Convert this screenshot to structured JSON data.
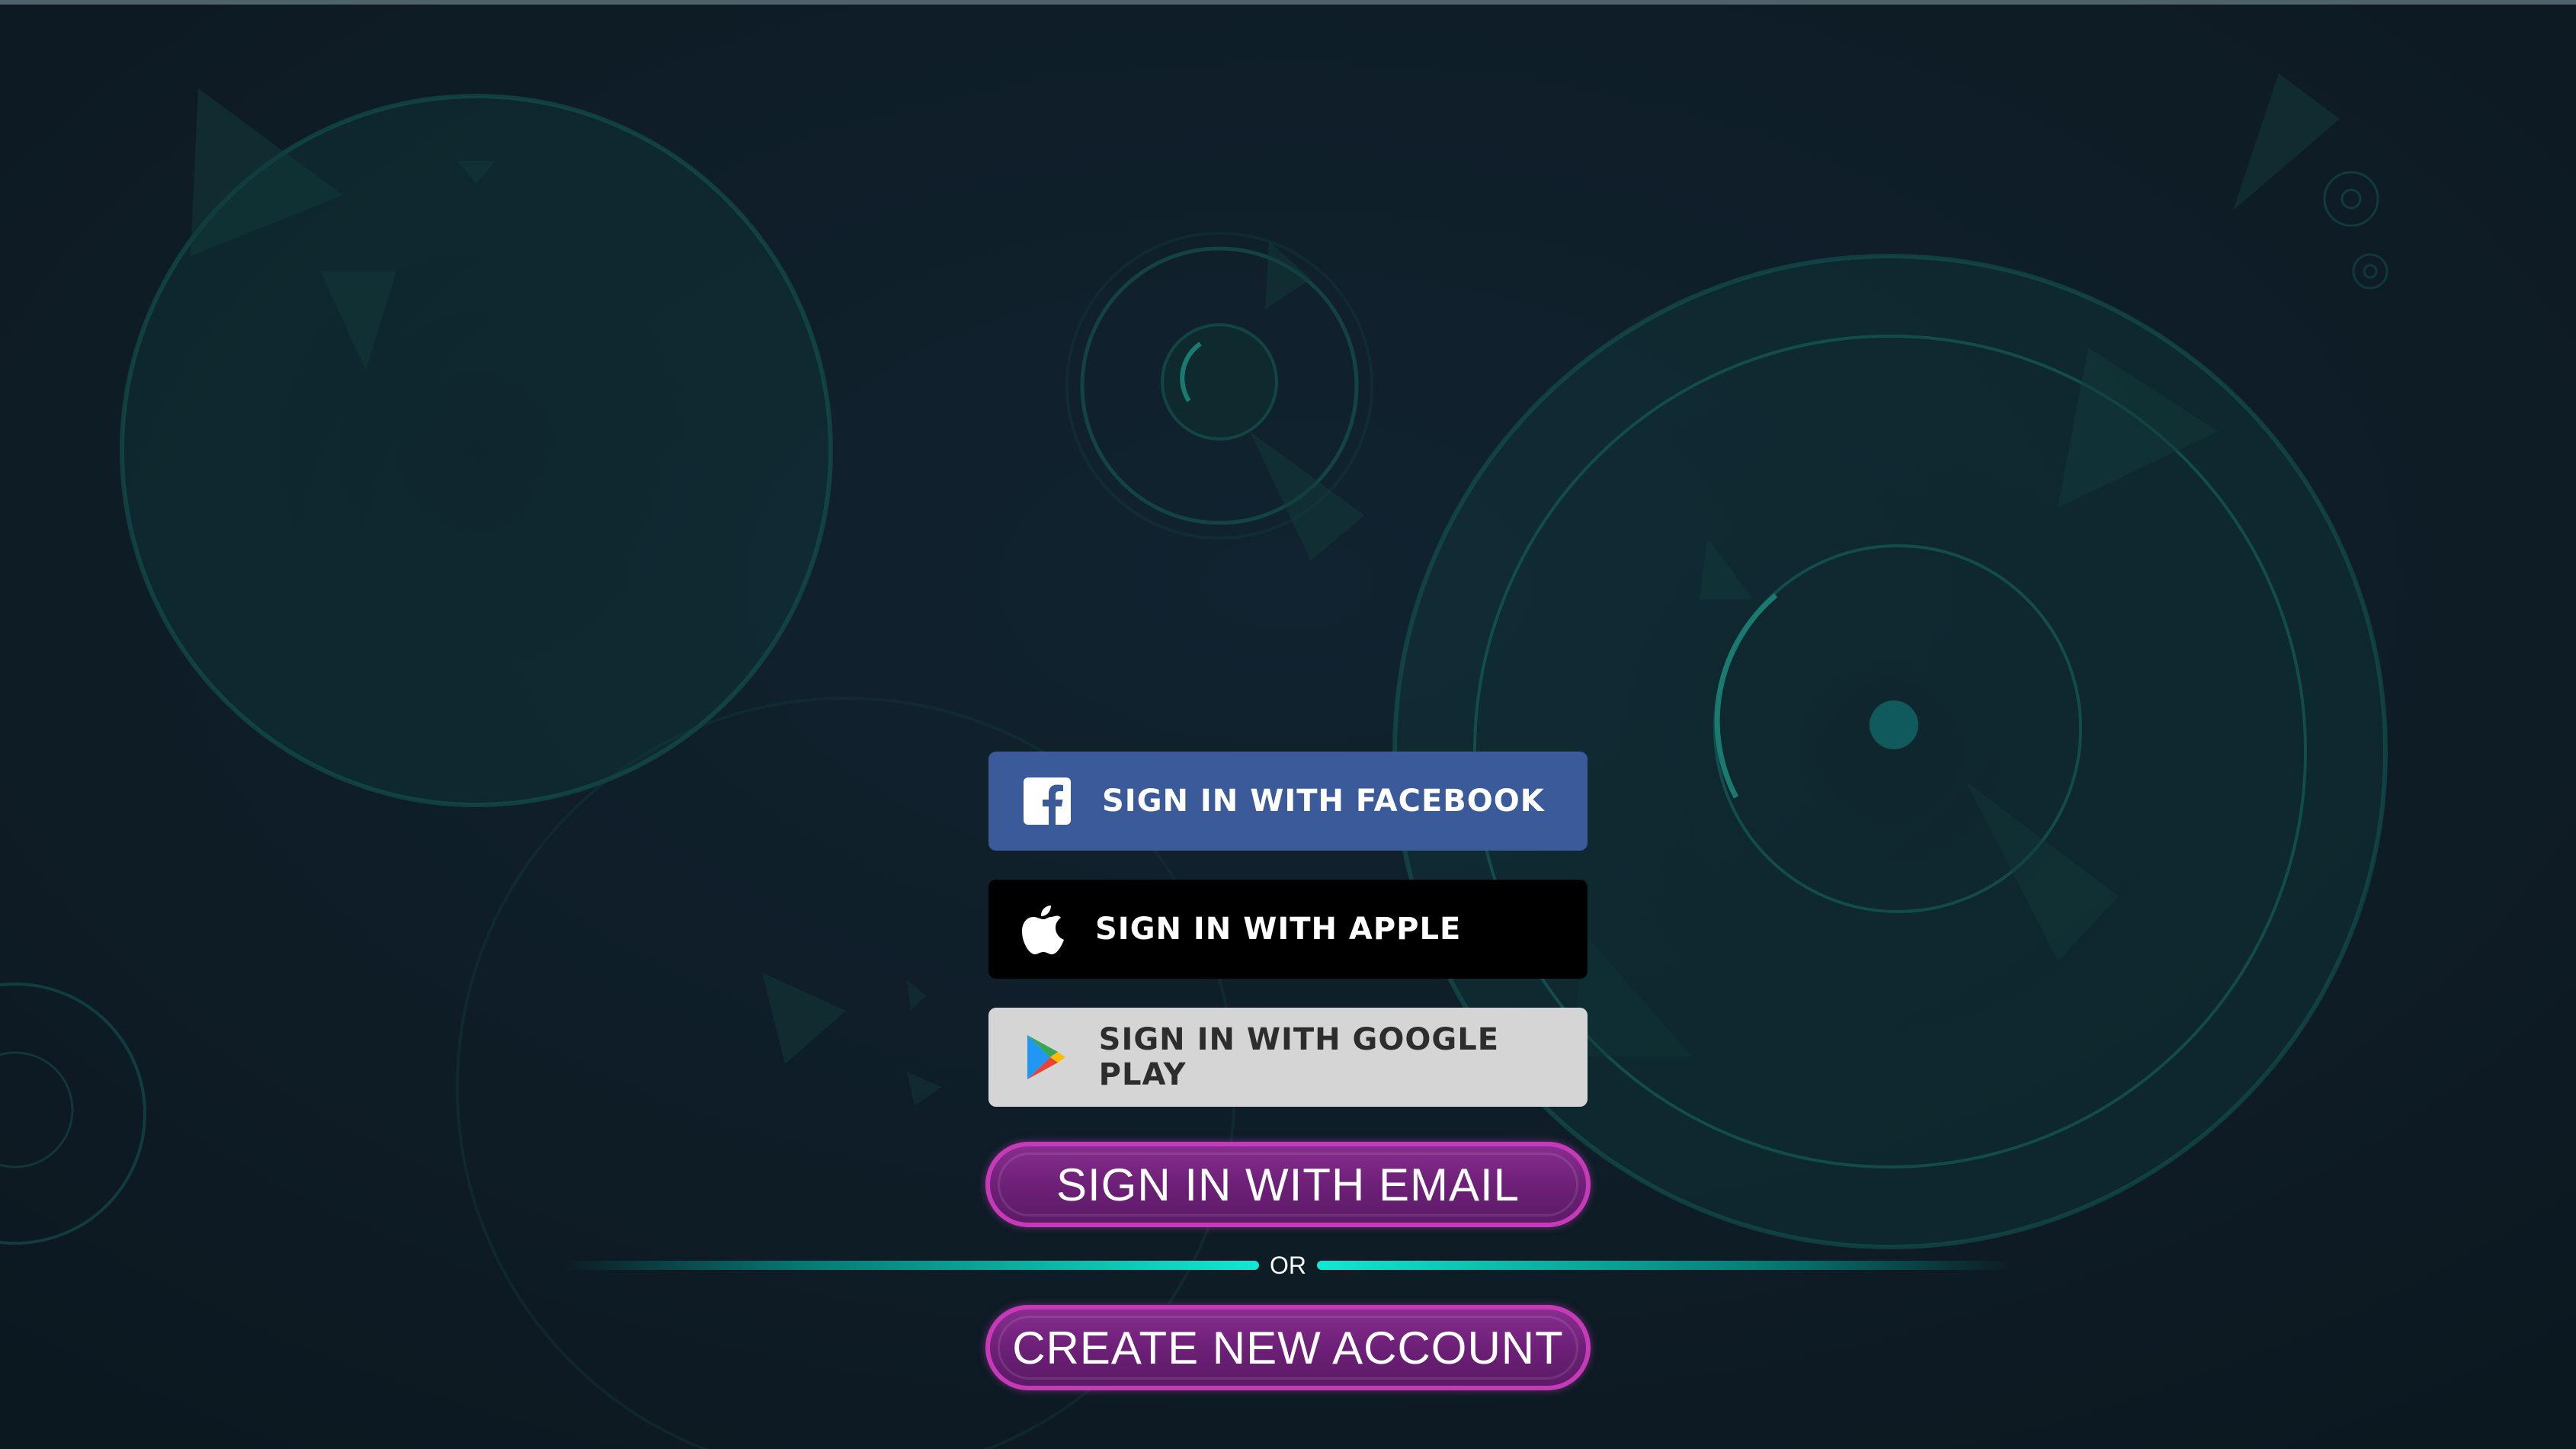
{
  "buttons": {
    "facebook_label": "SIGN IN WITH FACEBOOK",
    "apple_label": "SIGN IN WITH APPLE",
    "google_label": "SIGN IN WITH GOOGLE PLAY",
    "email_label": "SIGN IN WITH EMAIL",
    "create_label": "CREATE NEW ACCOUNT"
  },
  "divider": {
    "text": "OR"
  },
  "icons": {
    "facebook": "facebook-icon",
    "apple": "apple-icon",
    "google": "google-play-icon"
  },
  "colors": {
    "background": "#0f1c25",
    "facebook": "#3b5a99",
    "apple": "#000000",
    "google_play": "#d5d5d5",
    "pill_fill": "#6b1f75",
    "pill_border": "#c63ab8",
    "divider_accent": "#12e8d2"
  }
}
